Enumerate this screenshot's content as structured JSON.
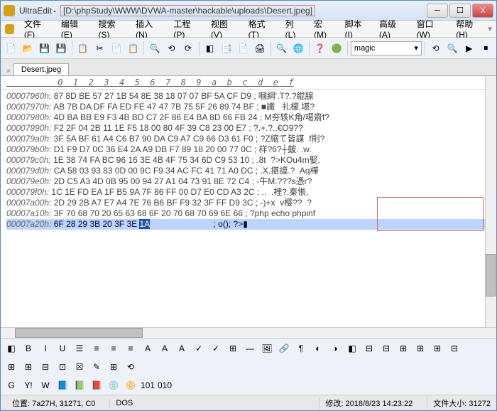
{
  "title": {
    "app": "UltraEdit",
    "path": "[D:\\phpStudy\\WWW\\DVWA-master\\hackable\\uploads\\Desert.jpeg]"
  },
  "win_buttons": {
    "min": "─",
    "max": "☐",
    "close": "X"
  },
  "menu": [
    "文件(F)",
    "编辑(E)",
    "搜索(S)",
    "插入(N)",
    "工程(P)",
    "视图(V)",
    "格式(T)",
    "列(L)",
    "宏(M)",
    "脚本(I)",
    "高级(A)",
    "窗口(W)",
    "帮助(H)"
  ],
  "toolbar1": [
    "📄",
    "📂",
    "💾",
    "💾",
    "📋",
    "✂",
    "📄",
    "📋",
    "🔍",
    "⟲",
    "⟳",
    "◧",
    "📑",
    "📄",
    "🖨",
    "🔍",
    "🌐",
    "❓",
    "🟢"
  ],
  "combo": {
    "value": "magic",
    "arrow": "▾"
  },
  "toolbar1_right": [
    "⟲",
    "🔍",
    "▶",
    "⏹"
  ],
  "tab": {
    "label": "Desert.jpeg",
    "close": "×"
  },
  "hex_header": "          0  1  2  3  4  5  6  7  8  9  a  b  c  d  e  f",
  "hex_rows": [
    {
      "off": "00007960h:",
      "bytes": " 87 8D BE 57 27 1B 54 8E 38 18 07 07 BF 5A CF D9 ",
      "txt": "; 嘓綱'.T?.?緄腺"
    },
    {
      "off": "00007970h:",
      "bytes": " AB 7B DA DF FA ED FE 47 47 7B 75 5F 26 89 74 BF ",
      "txt": "; ■讖   礼檬.堪?"
    },
    {
      "off": "00007980h:",
      "bytes": " 4D BA BB E9 F3 4B BD C7 2F 86 E4 BA 8D 66 FB 24 ",
      "txt": "; M夯轶K角/噶齋f?"
    },
    {
      "off": "00007990h:",
      "bytes": " F2 2F 04 2B 11 1E F5 18 00 80 4F 39 C8 23 00 E7 ",
      "txt": "; ?.+.?..€O9??"
    },
    {
      "off": "000079a0h:",
      "bytes": " 3F 5A BF 61 A4 C6 B7 90 DA C9 A7 C9 66 D3 61 F0 ",
      "txt": "; ?Z縮て皆謀  f削?"
    },
    {
      "off": "000079b0h:",
      "bytes": " D1 F9 D7 0C 36 E4 2A A9 DB F7 89 18 20 00 77 0C ",
      "txt": "; 样?6?┼皷. .w."
    },
    {
      "off": "000079c0h:",
      "bytes": " 1E 38 74 FA BC 96 16 3E 4B 4F 75 34 6D C9 53 10 ",
      "txt": "; .8t  ?>KOu4m娶."
    },
    {
      "off": "000079d0h:",
      "bytes": " CA 58 03 93 83 0D 00 9C F9 34 AC FC 41 71 A0 DC ",
      "txt": "; .X.揕謨.?  Aq樺"
    },
    {
      "off": "000079e0h:",
      "bytes": " 2D C5 A3 4D 0B 95 00 94 27 A1 04 73 91 8E 72 C4 ",
      "txt": "; -牛M.???s憑r?"
    },
    {
      "off": "000079f0h:",
      "bytes": " 1C 1E FD EA 1F B5 9A 7F 86 FF 00 D7 E0 CD A3 2C ",
      "txt": "; ..  .裡?.秦悵,"
    },
    {
      "off": "00007a00h:",
      "bytes": " 2D 29 2B A7 E7 A4 7E 76 B6 BF F9 32 3F FF D9 3C ",
      "txt": "; -)+x  v樱??  ?"
    },
    {
      "off": "00007a10h:",
      "bytes": " 3F 70 68 70 20 65 63 68 6F 20 70 68 70 69 6E 66 ",
      "txt": "; ?php echo phpinf"
    },
    {
      "off": "00007a20h:",
      "bytes": " 6F 28 29 3B 20 3F 3E ",
      "sel": "1A",
      "txt": "                           ; o(); ?>▮"
    }
  ],
  "toolbar2_r1": [
    "◧",
    "B",
    "I",
    "U",
    "☰",
    "≡",
    "≡",
    "≡",
    "A",
    "A",
    "A",
    "✓",
    "✓",
    "⊞",
    "—",
    "🖼",
    "🔗",
    "¶",
    "◐",
    "◑",
    "◧",
    "⊟",
    "⊟",
    "⊞",
    "⊞",
    "⊞",
    "⊟"
  ],
  "toolbar2_r2": [
    "⊞",
    "⊞",
    "⊟",
    "⊡",
    "☒",
    "✎",
    "⊞",
    "⟲"
  ],
  "toolbar2_r3": [
    "G",
    "Y!",
    "W",
    "📘",
    "📗",
    "📕",
    "💿",
    "📀",
    "101",
    "010"
  ],
  "status": {
    "pos_label": "位置:",
    "pos_value": "7a27H, 31271, C0",
    "mode": "DOS",
    "mod_label": "修改:",
    "mod_value": "2018/8/23 14:23:22",
    "size_label": "文件大小:",
    "size_value": "31272"
  }
}
